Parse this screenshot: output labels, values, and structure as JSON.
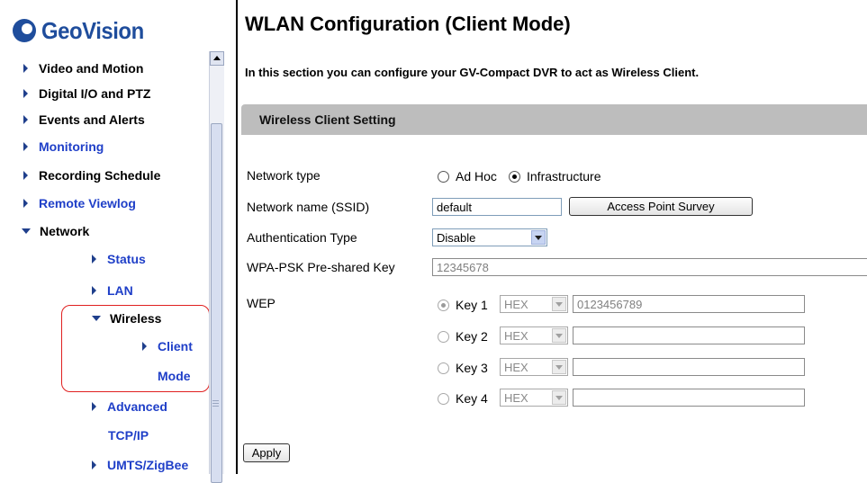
{
  "nav": {
    "brand": "GeoVision",
    "items": [
      {
        "label": "Video and Motion"
      },
      {
        "label": "Digital I/O and PTZ"
      },
      {
        "label": "Events and Alerts"
      },
      {
        "label": "Monitoring"
      },
      {
        "label": "Recording Schedule"
      },
      {
        "label": "Remote Viewlog"
      },
      {
        "label": "Network"
      },
      {
        "label": "Status"
      },
      {
        "label": "LAN"
      },
      {
        "label": "Wireless"
      },
      {
        "label": "Client"
      },
      {
        "label": "Mode"
      },
      {
        "label": "Advanced"
      },
      {
        "label": "TCP/IP"
      },
      {
        "label": "UMTS/ZigBee"
      }
    ]
  },
  "page": {
    "title": "WLAN Configuration (Client Mode)",
    "intro": "In this section you can configure your GV-Compact DVR to act as Wireless Client.",
    "section_title": "Wireless Client Setting"
  },
  "form": {
    "network_type_label": "Network type",
    "network_type_options": [
      "Ad Hoc",
      "Infrastructure"
    ],
    "network_type_selected": "Infrastructure",
    "ssid_label": "Network name (SSID)",
    "ssid_value": "default",
    "survey_button": "Access Point Survey",
    "auth_label": "Authentication Type",
    "auth_value": "Disable",
    "psk_label": "WPA-PSK Pre-shared Key",
    "psk_value": "12345678",
    "wep_label": "WEP",
    "wep_keys": [
      {
        "label": "Key 1",
        "format": "HEX",
        "value": "0123456789",
        "checked": true
      },
      {
        "label": "Key 2",
        "format": "HEX",
        "value": "",
        "checked": false
      },
      {
        "label": "Key 3",
        "format": "HEX",
        "value": "",
        "checked": false
      },
      {
        "label": "Key 4",
        "format": "HEX",
        "value": "",
        "checked": false
      }
    ],
    "apply_button": "Apply"
  },
  "colors": {
    "brand_blue": "#1f4d9c",
    "link_blue": "#1f3fc8",
    "highlight_red": "#e02020",
    "section_bar": "#bdbdbd"
  }
}
